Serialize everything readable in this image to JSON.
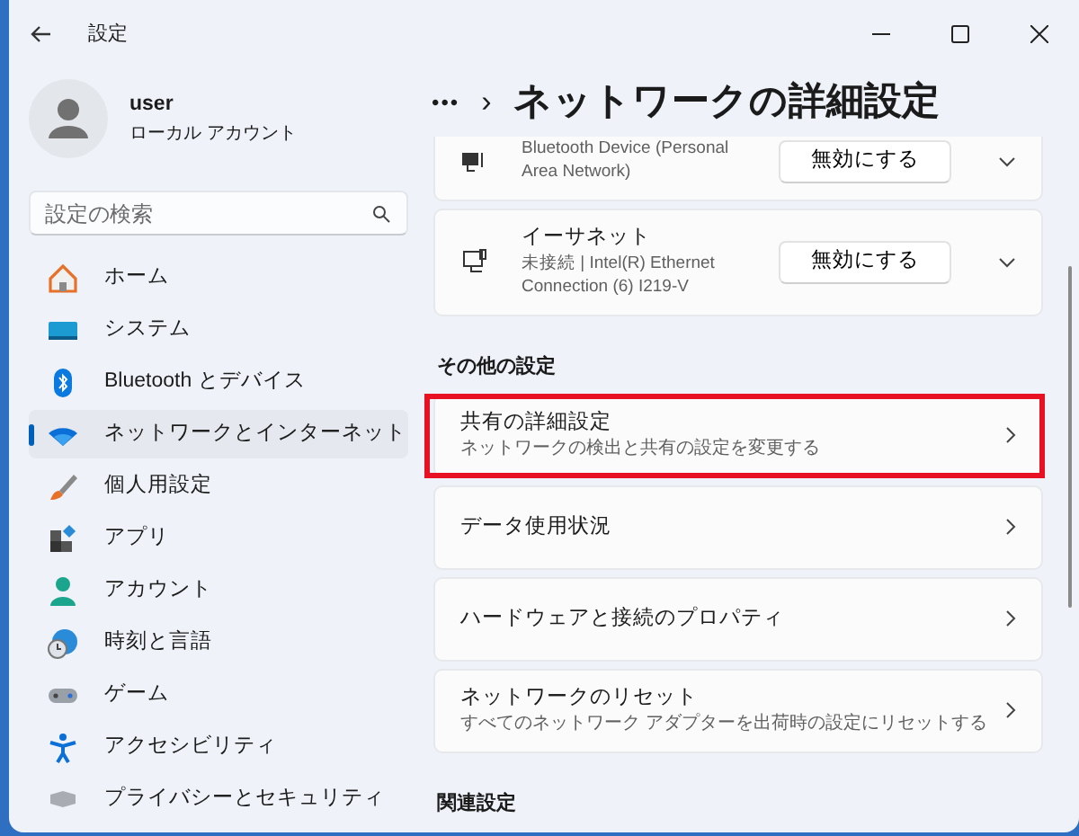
{
  "window": {
    "title": "設定"
  },
  "account": {
    "name": "user",
    "type": "ローカル アカウント"
  },
  "search": {
    "placeholder": "設定の検索"
  },
  "sidebar": {
    "items": [
      {
        "label": "ホーム",
        "selected": false
      },
      {
        "label": "システム",
        "selected": false
      },
      {
        "label": "Bluetooth とデバイス",
        "selected": false
      },
      {
        "label": "ネットワークとインターネット",
        "selected": true
      },
      {
        "label": "個人用設定",
        "selected": false
      },
      {
        "label": "アプリ",
        "selected": false
      },
      {
        "label": "アカウント",
        "selected": false
      },
      {
        "label": "時刻と言語",
        "selected": false
      },
      {
        "label": "ゲーム",
        "selected": false
      },
      {
        "label": "アクセシビリティ",
        "selected": false
      },
      {
        "label": "プライバシーとセキュリティ",
        "selected": false
      }
    ]
  },
  "breadcrumb": {
    "more": "•••",
    "separator": "›",
    "title": "ネットワークの詳細設定"
  },
  "adapters": [
    {
      "detail": "Bluetooth Device (Personal Area Network)",
      "button": "無効にする"
    },
    {
      "name": "イーサネット",
      "detail": "未接続 | Intel(R) Ethernet Connection (6) I219-V",
      "button": "無効にする"
    }
  ],
  "sections": [
    {
      "heading": "その他の設定",
      "items": [
        {
          "title": "共有の詳細設定",
          "subtitle": "ネットワークの検出と共有の設定を変更する",
          "highlighted": true
        },
        {
          "title": "データ使用状況",
          "highlighted": false
        },
        {
          "title": "ハードウェアと接続のプロパティ",
          "highlighted": false
        },
        {
          "title": "ネットワークのリセット",
          "subtitle": "すべてのネットワーク アダプターを出荷時の設定にリセットする",
          "highlighted": false
        }
      ]
    },
    {
      "heading": "関連設定"
    }
  ]
}
